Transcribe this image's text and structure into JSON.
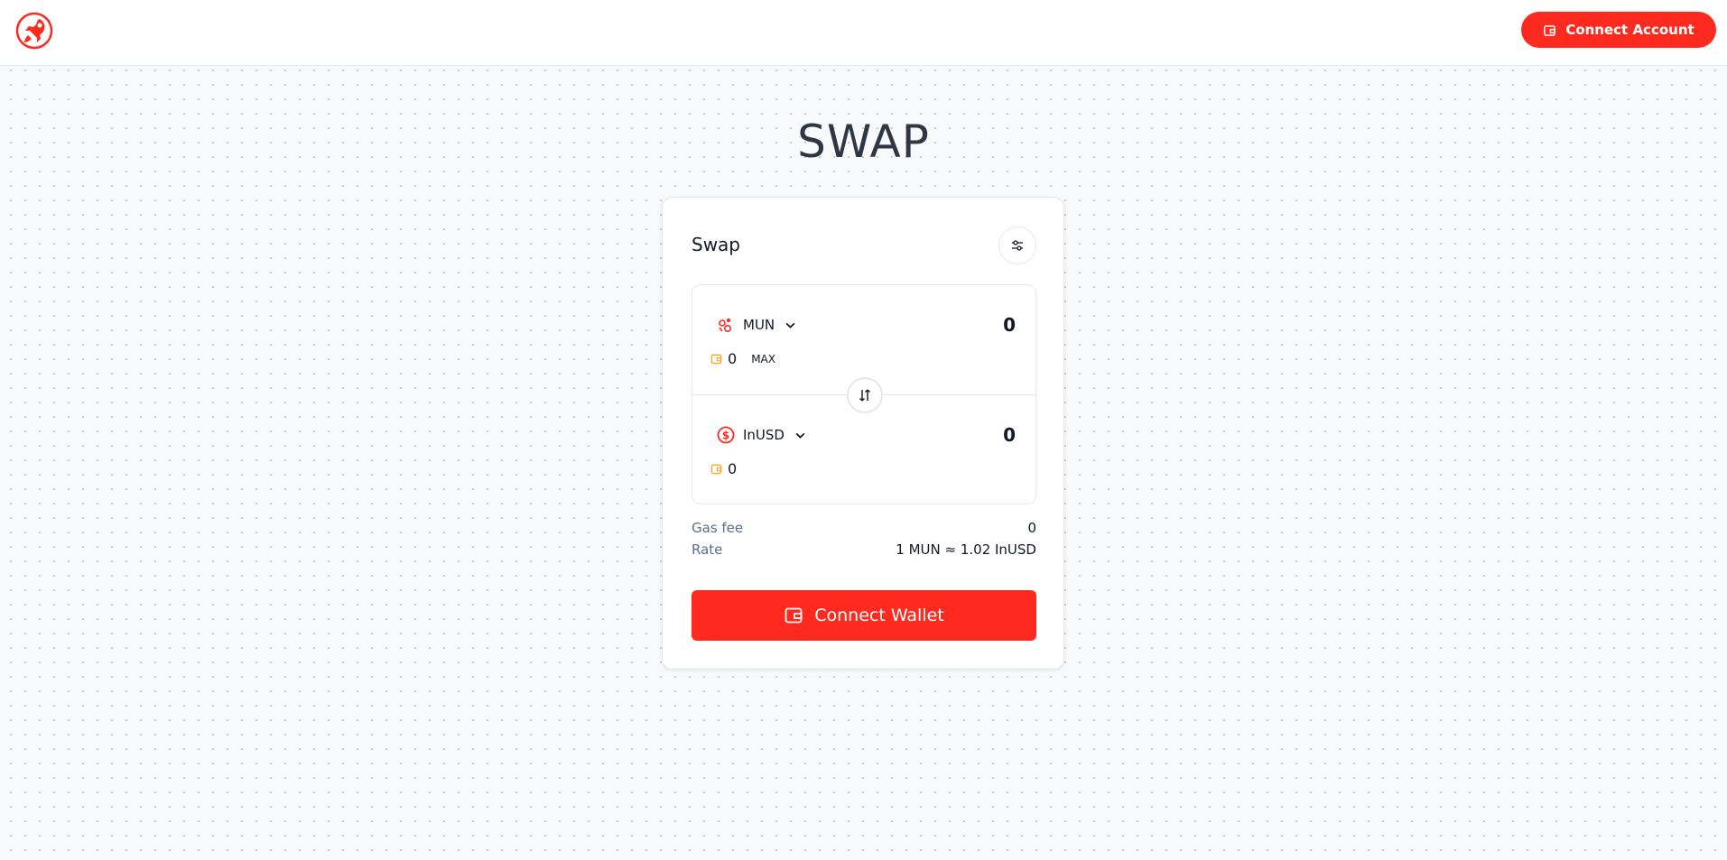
{
  "header": {
    "logo_icon": "rocket-logo-icon",
    "connect_account_label": "Connect Account"
  },
  "page": {
    "title": "SWAP"
  },
  "swap": {
    "card_title": "Swap",
    "settings_icon": "sliders-icon",
    "from": {
      "token": "MUN",
      "token_icon": "mun-token-icon",
      "amount": "0",
      "balance": "0",
      "max_label": "MAX"
    },
    "switch_icon": "swap-arrows-icon",
    "to": {
      "token": "InUSD",
      "token_icon": "dollar-circle-icon",
      "amount": "0",
      "balance": "0"
    },
    "gas_fee_label": "Gas fee",
    "gas_fee_value": "0",
    "rate_label": "Rate",
    "rate_value": "1 MUN ≈ 1.02 InUSD",
    "connect_wallet_label": "Connect Wallet"
  },
  "colors": {
    "accent": "#ff2a1f",
    "balance_icon": "#f5a623",
    "title": "#2f3743",
    "muted": "#5b6f8a"
  }
}
